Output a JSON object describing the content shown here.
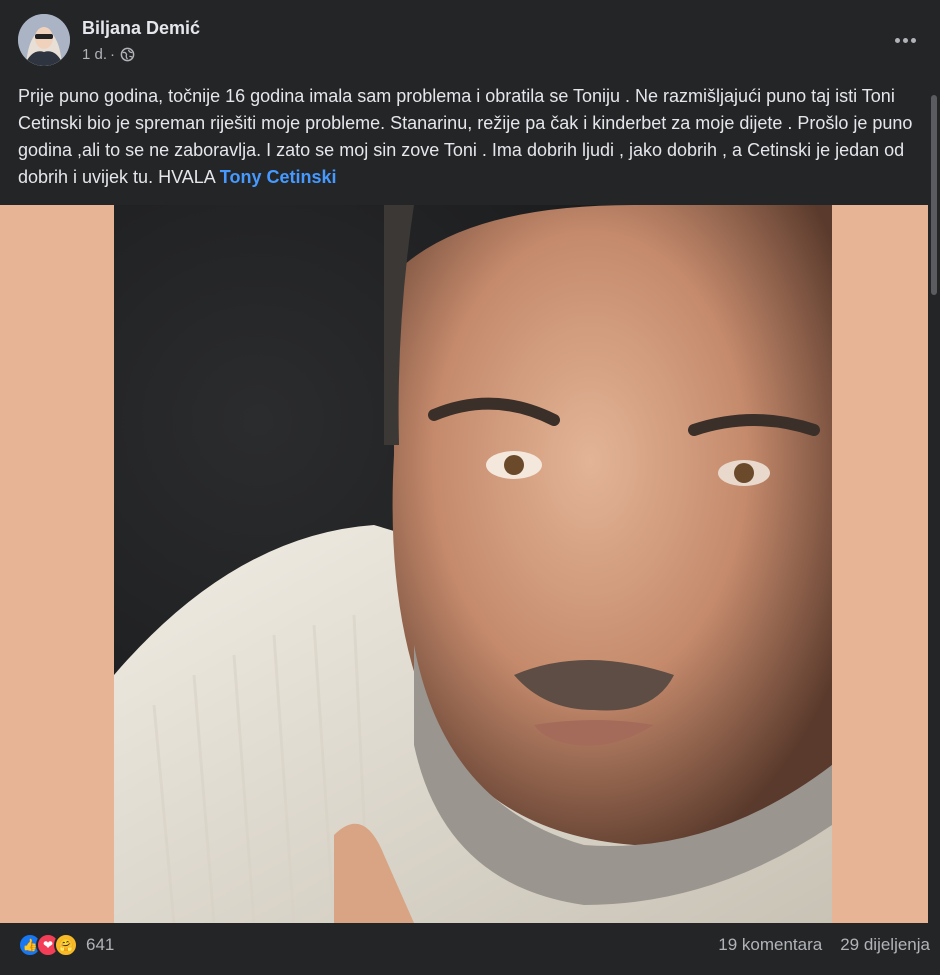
{
  "post": {
    "author": "Biljana Demić",
    "time": "1 d.",
    "separator": "·",
    "audience_icon": "globe-icon",
    "more_icon": "more-options-icon",
    "text": "Prije puno godina, točnije 16 godina imala sam problema i obratila se Toniju . Ne razmišljajući puno taj isti Toni Cetinski bio je spreman riješiti moje probleme. Stanarinu, režije pa čak i kinderbet za moje dijete . Prošlo je puno godina ,ali to se ne zaboravlja. I zato se moj sin zove Toni . Ima dobrih ljudi , jako dobrih , a Cetinski je jedan od dobrih i uvijek tu. HVALA",
    "mention": "Tony Cetinski"
  },
  "footer": {
    "reaction_icons": [
      "like-icon",
      "love-icon",
      "care-icon"
    ],
    "reaction_count": "641",
    "comments": "19 komentara",
    "shares": "29 dijeljenja"
  },
  "colors": {
    "background": "#242526",
    "media_background": "#e7b596",
    "text": "#e4e6eb",
    "secondary_text": "#b0b3b8",
    "mention": "#4599ff",
    "like": "#1877f2",
    "love": "#f33e58",
    "care": "#f7b928"
  }
}
